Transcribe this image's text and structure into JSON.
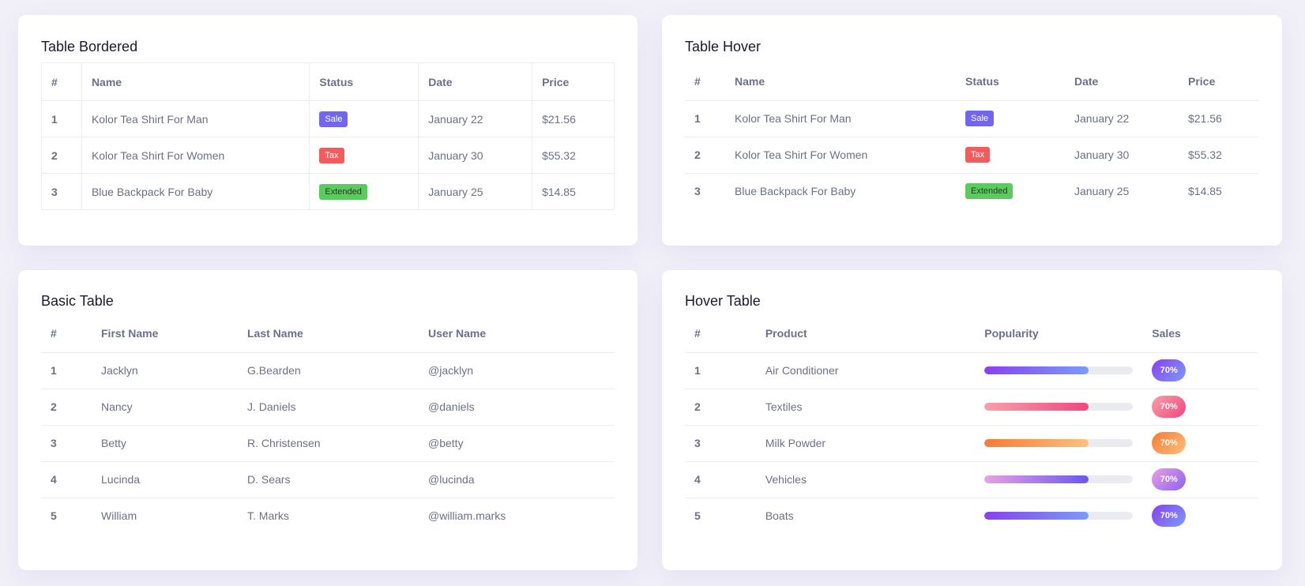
{
  "bordered": {
    "title": "Table Bordered",
    "headers": [
      "#",
      "Name",
      "Status",
      "Date",
      "Price"
    ],
    "rows": [
      {
        "idx": "1",
        "name": "Kolor Tea Shirt For Man",
        "status": "Sale",
        "date": "January 22",
        "price": "$21.56"
      },
      {
        "idx": "2",
        "name": "Kolor Tea Shirt For Women",
        "status": "Tax",
        "date": "January 30",
        "price": "$55.32"
      },
      {
        "idx": "3",
        "name": "Blue Backpack For Baby",
        "status": "Extended",
        "date": "January 25",
        "price": "$14.85"
      }
    ]
  },
  "hover": {
    "title": "Table Hover",
    "headers": [
      "#",
      "Name",
      "Status",
      "Date",
      "Price"
    ],
    "rows": [
      {
        "idx": "1",
        "name": "Kolor Tea Shirt For Man",
        "status": "Sale",
        "date": "January 22",
        "price": "$21.56"
      },
      {
        "idx": "2",
        "name": "Kolor Tea Shirt For Women",
        "status": "Tax",
        "date": "January 30",
        "price": "$55.32"
      },
      {
        "idx": "3",
        "name": "Blue Backpack For Baby",
        "status": "Extended",
        "date": "January 25",
        "price": "$14.85"
      }
    ]
  },
  "basic": {
    "title": "Basic Table",
    "headers": [
      "#",
      "First Name",
      "Last Name",
      "User Name"
    ],
    "rows": [
      {
        "idx": "1",
        "first": "Jacklyn",
        "last": "G.Bearden",
        "user": "@jacklyn"
      },
      {
        "idx": "2",
        "first": "Nancy",
        "last": "J. Daniels",
        "user": "@daniels"
      },
      {
        "idx": "3",
        "first": "Betty",
        "last": "R. Christensen",
        "user": "@betty"
      },
      {
        "idx": "4",
        "first": "Lucinda",
        "last": "D. Sears",
        "user": "@lucinda"
      },
      {
        "idx": "5",
        "first": "William",
        "last": "T. Marks",
        "user": "@william.marks"
      }
    ]
  },
  "hover_table": {
    "title": "Hover Table",
    "headers": [
      "#",
      "Product",
      "Popularity",
      "Sales"
    ],
    "rows": [
      {
        "idx": "1",
        "product": "Air Conditioner",
        "popularity": 0.7,
        "sales": "70%"
      },
      {
        "idx": "2",
        "product": "Textiles",
        "popularity": 0.7,
        "sales": "70%"
      },
      {
        "idx": "3",
        "product": "Milk Powder",
        "popularity": 0.7,
        "sales": "70%"
      },
      {
        "idx": "4",
        "product": "Vehicles",
        "popularity": 0.7,
        "sales": "70%"
      },
      {
        "idx": "5",
        "product": "Boats",
        "popularity": 0.7,
        "sales": "70%"
      }
    ]
  },
  "colors": {
    "badge_sale": "#7266f0",
    "badge_tax": "#f25c5c",
    "badge_extended": "#5ccb5f",
    "background": "#f1f0f8"
  }
}
